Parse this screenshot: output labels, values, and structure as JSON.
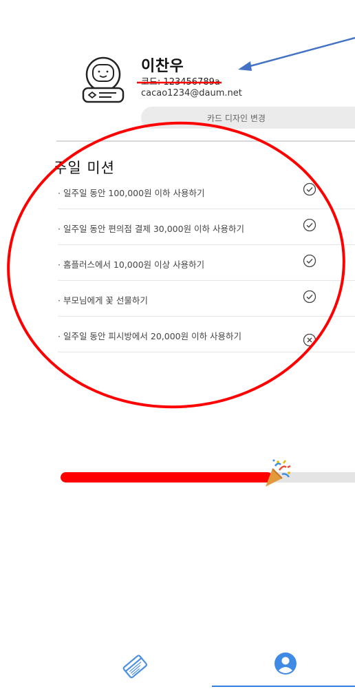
{
  "colors": {
    "accent": "#2f7fe0",
    "annotation_red": "#ff0000",
    "annotation_arrow": "#4472c4",
    "track": "#e4e4e4"
  },
  "profile": {
    "name": "이찬우",
    "code": "코드: 123456789a",
    "email": "cacao1234@daum.net",
    "avatar_icon": "robot-avatar-icon"
  },
  "card_design_button": {
    "label": "카드 디자인 변경"
  },
  "missions": {
    "title": "주일 미션",
    "items": [
      {
        "label": "· 일주일 동안 100,000원 이하 사용하기",
        "status": "done",
        "icon": "check-circle-icon"
      },
      {
        "label": "· 일주일 동안 편의점 결제 30,000원 이하 사용하기",
        "status": "done",
        "icon": "check-circle-icon"
      },
      {
        "label": "· 홈플러스에서 10,000원 이상 사용하기",
        "status": "done",
        "icon": "check-circle-icon"
      },
      {
        "label": "· 부모님에게 꽃 선물하기",
        "status": "done",
        "icon": "check-circle-icon"
      },
      {
        "label": "· 일주일 동안 피시방에서 20,000원 이하 사용하기",
        "status": "failed",
        "icon": "x-circle-icon"
      }
    ]
  },
  "progress": {
    "value_fraction": 0.7,
    "icon": "party-popper-icon"
  },
  "bottom_nav": {
    "items": [
      {
        "name": "card",
        "icon": "credit-card-icon",
        "active": false
      },
      {
        "name": "profile",
        "icon": "user-circle-icon",
        "active": true
      }
    ]
  }
}
